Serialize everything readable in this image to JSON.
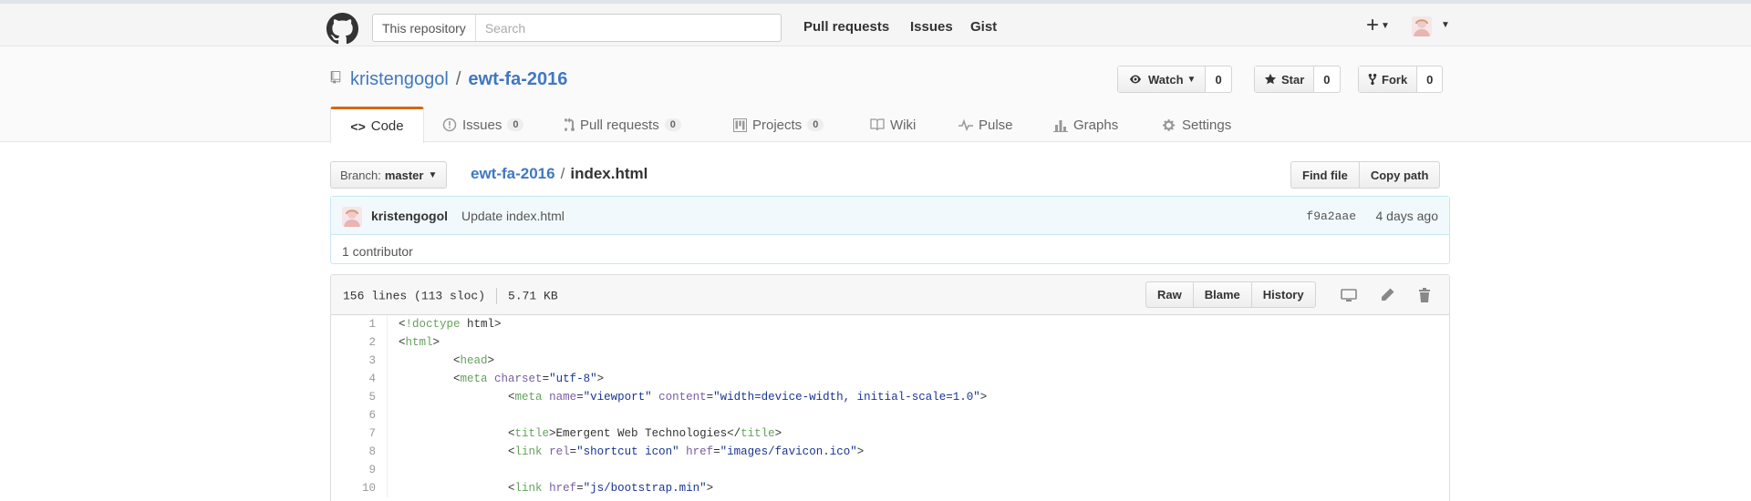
{
  "header": {
    "search_scope": "This repository",
    "search_placeholder": "Search",
    "nav": [
      "Pull requests",
      "Issues",
      "Gist"
    ],
    "new_icon": "plus-icon",
    "avatar_icon": "avatar"
  },
  "repo": {
    "owner": "kristengogol",
    "separator": "/",
    "name": "ewt-fa-2016",
    "watch_label": "Watch",
    "watch_count": "0",
    "star_label": "Star",
    "star_count": "0",
    "fork_label": "Fork",
    "fork_count": "0"
  },
  "tabs": [
    {
      "label": "Code",
      "icon": "code-icon"
    },
    {
      "label": "Issues",
      "count": "0",
      "icon": "issue-icon"
    },
    {
      "label": "Pull requests",
      "count": "0",
      "icon": "pull-request-icon"
    },
    {
      "label": "Projects",
      "count": "0",
      "icon": "project-icon"
    },
    {
      "label": "Wiki",
      "icon": "book-icon"
    },
    {
      "label": "Pulse",
      "icon": "pulse-icon"
    },
    {
      "label": "Graphs",
      "icon": "graph-icon"
    },
    {
      "label": "Settings",
      "icon": "gear-icon"
    }
  ],
  "file_nav": {
    "branch_label": "Branch:",
    "branch_value": "master",
    "breadcrumb_repo": "ewt-fa-2016",
    "breadcrumb_sep": "/",
    "breadcrumb_file": "index.html",
    "find_file": "Find file",
    "copy_path": "Copy path"
  },
  "commit": {
    "author": "kristengogol",
    "message": "Update index.html",
    "sha": "f9a2aae",
    "time": "4 days ago",
    "contributors": "1 contributor"
  },
  "file": {
    "lines_info": "156 lines (113 sloc)",
    "size": "5.71 KB",
    "raw": "Raw",
    "blame": "Blame",
    "history": "History"
  },
  "code_lines": [
    {
      "n": "1",
      "text": "<!doctype html>"
    },
    {
      "n": "2",
      "text": "<html>"
    },
    {
      "n": "3",
      "text": "        <head>"
    },
    {
      "n": "4",
      "text": "        <meta charset=\"utf-8\">"
    },
    {
      "n": "5",
      "text": "                <meta name=\"viewport\" content=\"width=device-width, initial-scale=1.0\">"
    },
    {
      "n": "6",
      "text": ""
    },
    {
      "n": "7",
      "text": "                <title>Emergent Web Technologies</title>"
    },
    {
      "n": "8",
      "text": "                <link rel=\"shortcut icon\" href=\"images/favicon.ico\">"
    },
    {
      "n": "9",
      "text": ""
    },
    {
      "n": "10",
      "text": "                <link href=\"js/bootstrap.min\">"
    }
  ],
  "colors": {
    "link": "#4078c0",
    "tab_accent": "#d26911",
    "commit_bg": "#f2f9fc",
    "tag": "#63a35c",
    "attr": "#795da3",
    "string": "#183691"
  }
}
